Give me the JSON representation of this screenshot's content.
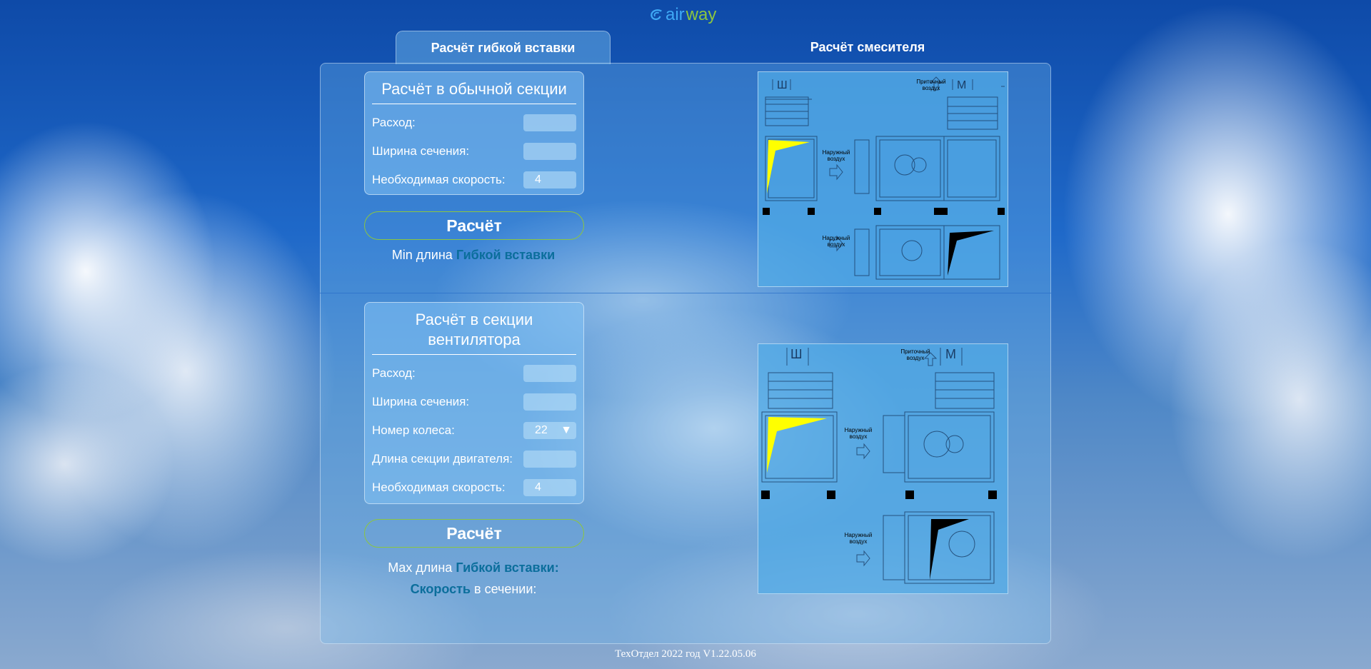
{
  "logo": {
    "air": "air",
    "way": "way"
  },
  "tabs": [
    {
      "label": "Расчёт гибкой вставки",
      "active": true
    },
    {
      "label": "Расчёт смесителя",
      "active": false
    }
  ],
  "section1": {
    "title": "Расчёт в обычной секции",
    "fields": [
      {
        "label": "Расход:",
        "value": ""
      },
      {
        "label": "Ширина сечения:",
        "value": ""
      },
      {
        "label": "Необходимая скорость:",
        "value": "4"
      }
    ],
    "button": "Расчёт",
    "result": {
      "prefix": "Min длина ",
      "highlight": "Гибкой вставки"
    }
  },
  "section2": {
    "title": "Расчёт в секции вентилятора",
    "fields": [
      {
        "label": "Расход:",
        "value": ""
      },
      {
        "label": "Ширина сечения:",
        "value": ""
      },
      {
        "label": "Номер колеса:",
        "value": "22"
      },
      {
        "label": "Длина секции двигателя:",
        "value": ""
      },
      {
        "label": "Необходимая скорость:",
        "value": "4"
      }
    ],
    "button": "Расчёт",
    "result1": {
      "prefix": "Max длина ",
      "highlight": "Гибкой вставки:"
    },
    "result2": {
      "highlight": "Скорость",
      "suffix": " в сечении:"
    }
  },
  "diagram_labels": {
    "supply": "Приточный воздух",
    "outdoor": "Наружный воздух",
    "w": "Ш",
    "m": "М"
  },
  "colors": {
    "accent": "#8cc63f",
    "highlight": "#0b6e9c",
    "flex_insert": "#ffff00"
  },
  "footer": "ТехОтдел 2022 год V1.22.05.06"
}
